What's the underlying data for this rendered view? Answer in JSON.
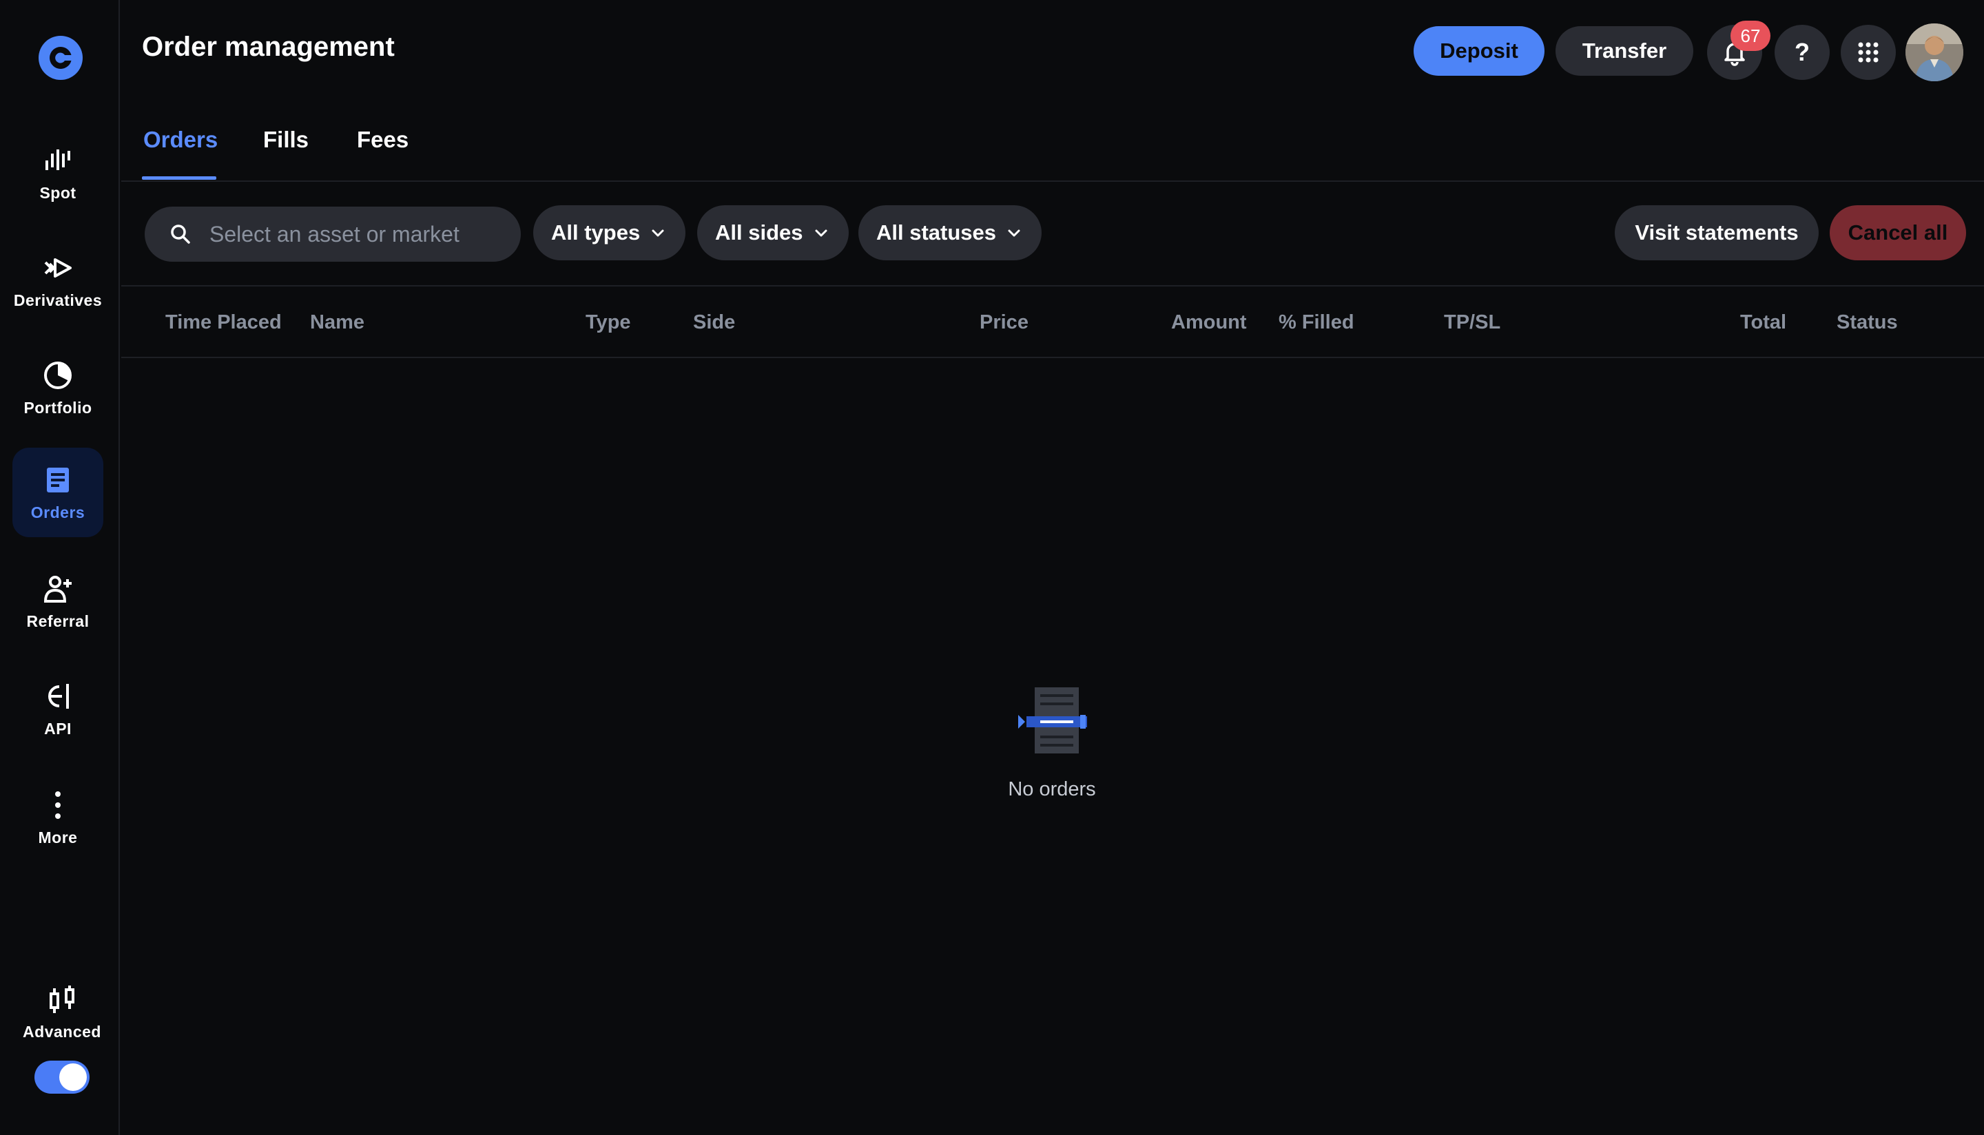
{
  "page": {
    "title": "Order management"
  },
  "sidebar": {
    "items": [
      {
        "label": "Spot",
        "icon": "spot-bars-icon"
      },
      {
        "label": "Derivatives",
        "icon": "derivatives-icon"
      },
      {
        "label": "Portfolio",
        "icon": "pie-chart-icon"
      },
      {
        "label": "Orders",
        "icon": "document-icon",
        "active": true
      },
      {
        "label": "Referral",
        "icon": "add-person-icon"
      },
      {
        "label": "API",
        "icon": "api-icon"
      },
      {
        "label": "More",
        "icon": "more-vertical-icon"
      },
      {
        "label": "Advanced",
        "icon": "candlestick-icon"
      }
    ],
    "advanced_toggle_on": true
  },
  "header": {
    "deposit_label": "Deposit",
    "transfer_label": "Transfer",
    "notification_count": "67",
    "help_label": "?"
  },
  "tabs": [
    {
      "label": "Orders",
      "active": true
    },
    {
      "label": "Fills"
    },
    {
      "label": "Fees"
    }
  ],
  "filters": {
    "search_placeholder": "Select an asset or market",
    "type": "All types",
    "side": "All sides",
    "status": "All statuses",
    "visit_statements_label": "Visit statements",
    "cancel_all_label": "Cancel all"
  },
  "table": {
    "columns": [
      "Time Placed",
      "Name",
      "Type",
      "Side",
      "Price",
      "Amount",
      "% Filled",
      "TP/SL",
      "Total",
      "Status"
    ],
    "rows": []
  },
  "empty_state": {
    "text": "No orders",
    "icon": "empty-orders-icon"
  },
  "colors": {
    "background": "#0a0b0d",
    "accent": "#5b8cff",
    "primary_button": "#4d84f7",
    "danger_button": "#7a2a31",
    "badge": "#e8525a"
  }
}
